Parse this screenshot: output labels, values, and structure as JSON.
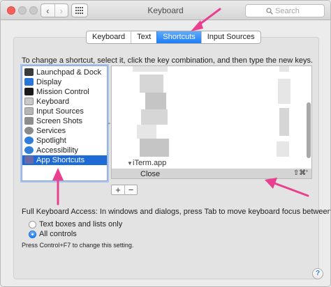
{
  "window": {
    "title": "Keyboard"
  },
  "toolbar": {
    "back_glyph": "‹",
    "forward_glyph": "›",
    "show_all_icon": "grid-icon",
    "search_placeholder": "Search"
  },
  "tabs": [
    {
      "label": "Keyboard",
      "active": false
    },
    {
      "label": "Text",
      "active": false
    },
    {
      "label": "Shortcuts",
      "active": true
    },
    {
      "label": "Input Sources",
      "active": false
    }
  ],
  "shortcuts": {
    "instructions": "To change a shortcut, select it, click the key combination, and then type the new keys.",
    "categories": [
      {
        "label": "Launchpad & Dock",
        "icon": "launchpad-icon",
        "color": "#3b3b3b",
        "selected": false
      },
      {
        "label": "Display",
        "icon": "display-icon",
        "color": "#2a76d8",
        "selected": false
      },
      {
        "label": "Mission Control",
        "icon": "mission-control-icon",
        "color": "#1a1a1a",
        "selected": false
      },
      {
        "label": "Keyboard",
        "icon": "keyboard-icon",
        "color": "#c9c9c9",
        "selected": false
      },
      {
        "label": "Input Sources",
        "icon": "input-sources-icon",
        "color": "#b5b5b5",
        "selected": false
      },
      {
        "label": "Screen Shots",
        "icon": "screenshot-icon",
        "color": "#8d8d8d",
        "selected": false
      },
      {
        "label": "Services",
        "icon": "gear-icon",
        "color": "#8a8a8a",
        "selected": false
      },
      {
        "label": "Spotlight",
        "icon": "spotlight-icon",
        "color": "#2f7ed8",
        "selected": false
      },
      {
        "label": "Accessibility",
        "icon": "accessibility-icon",
        "color": "#2f7ed8",
        "selected": false
      },
      {
        "label": "App Shortcuts",
        "icon": "app-shortcuts-icon",
        "color": "#6a6aa8",
        "selected": true
      }
    ],
    "app_group": {
      "disclosure": "▼",
      "name": "iTerm.app"
    },
    "selected_row": {
      "name": "Close",
      "keys": "⇧⌘'"
    },
    "add_label": "+",
    "remove_label": "−"
  },
  "full_keyboard_access": {
    "label": "Full Keyboard Access: In windows and dialogs, press Tab to move keyboard focus between:",
    "options": [
      {
        "label": "Text boxes and lists only",
        "selected": false
      },
      {
        "label": "All controls",
        "selected": true
      }
    ],
    "note": "Press Control+F7 to change this setting."
  },
  "help": {
    "label": "?"
  },
  "colors": {
    "accent": "#1c7df6",
    "selection": "#1e6bd6",
    "annotation_arrows": "#ea3f8f"
  }
}
